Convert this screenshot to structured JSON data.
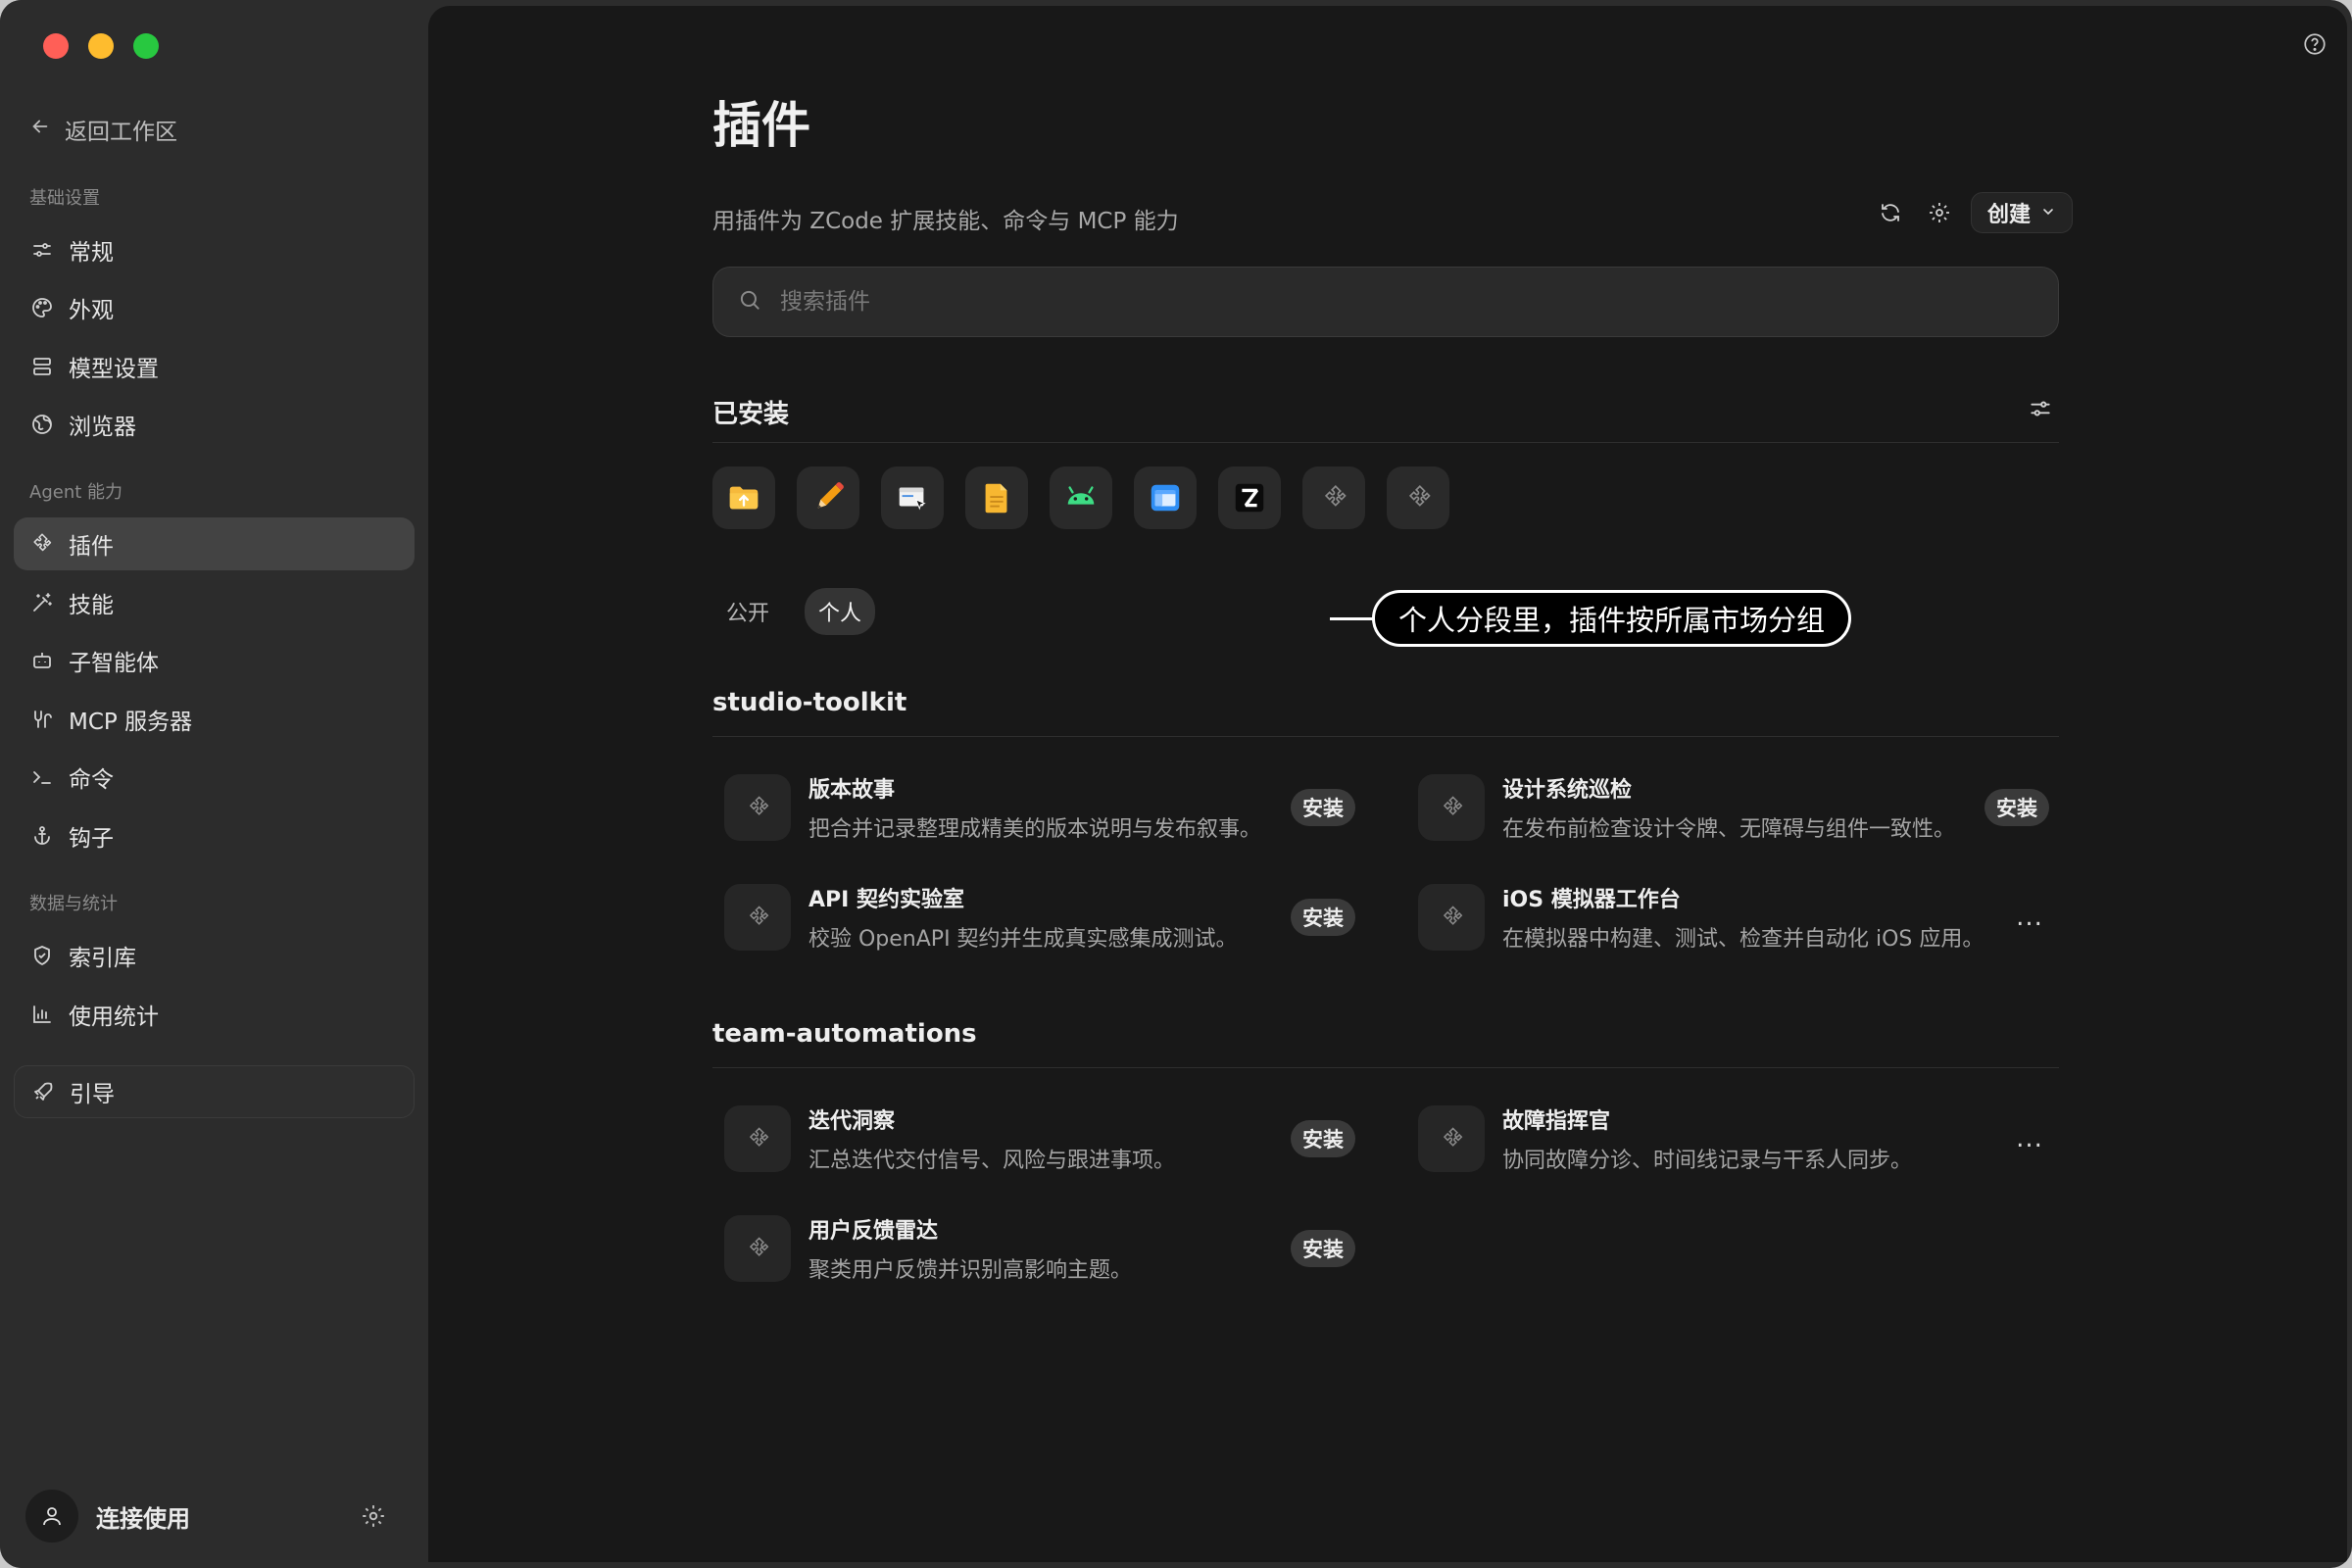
{
  "sidebar": {
    "back_label": "返回工作区",
    "sections": {
      "basic": "基础设置",
      "agent": "Agent 能力",
      "data": "数据与统计"
    },
    "items": {
      "general": "常规",
      "appearance": "外观",
      "model": "模型设置",
      "browser": "浏览器",
      "plugins": "插件",
      "skills": "技能",
      "subagents": "子智能体",
      "mcp": "MCP 服务器",
      "commands": "命令",
      "hooks": "钩子",
      "index": "索引库",
      "usage": "使用统计",
      "guide": "引导"
    },
    "user_label": "连接使用"
  },
  "main": {
    "title": "插件",
    "subtitle": "用插件为 ZCode 扩展技能、命令与 MCP 能力",
    "create_label": "创建",
    "search_placeholder": "搜索插件",
    "installed_title": "已安装",
    "installed_icons": [
      "folder-upload-icon",
      "pencil-icon",
      "window-cursor-icon",
      "document-icon",
      "android-icon",
      "finder-window-icon",
      "z-logo-icon",
      "puzzle-icon",
      "puzzle-icon"
    ],
    "segments": {
      "public": "公开",
      "personal": "个人"
    },
    "callout": "个人分段里，插件按所属市场分组",
    "groups": [
      {
        "title": "studio-toolkit",
        "plugins": [
          {
            "name": "版本故事",
            "desc": "把合并记录整理成精美的版本说明与发布叙事。",
            "action": "安装"
          },
          {
            "name": "设计系统巡检",
            "desc": "在发布前检查设计令牌、无障碍与组件一致性。",
            "action": "安装"
          },
          {
            "name": "API 契约实验室",
            "desc": "校验 OpenAPI 契约并生成真实感集成测试。",
            "action": "安装"
          },
          {
            "name": "iOS 模拟器工作台",
            "desc": "在模拟器中构建、测试、检查并自动化 iOS 应用。",
            "action": "..."
          }
        ]
      },
      {
        "title": "team-automations",
        "plugins": [
          {
            "name": "迭代洞察",
            "desc": "汇总迭代交付信号、风险与跟进事项。",
            "action": "安装"
          },
          {
            "name": "故障指挥官",
            "desc": "协同故障分诊、时间线记录与干系人同步。",
            "action": "..."
          },
          {
            "name": "用户反馈雷达",
            "desc": "聚类用户反馈并识别高影响主题。",
            "action": "安装"
          }
        ]
      }
    ]
  },
  "colors": {
    "close": "#ff5f57",
    "minimize": "#febc2e",
    "zoom": "#28c840",
    "sidebar_bg": "#2c2c2c",
    "main_bg": "#181818",
    "active_item": "#434343"
  }
}
